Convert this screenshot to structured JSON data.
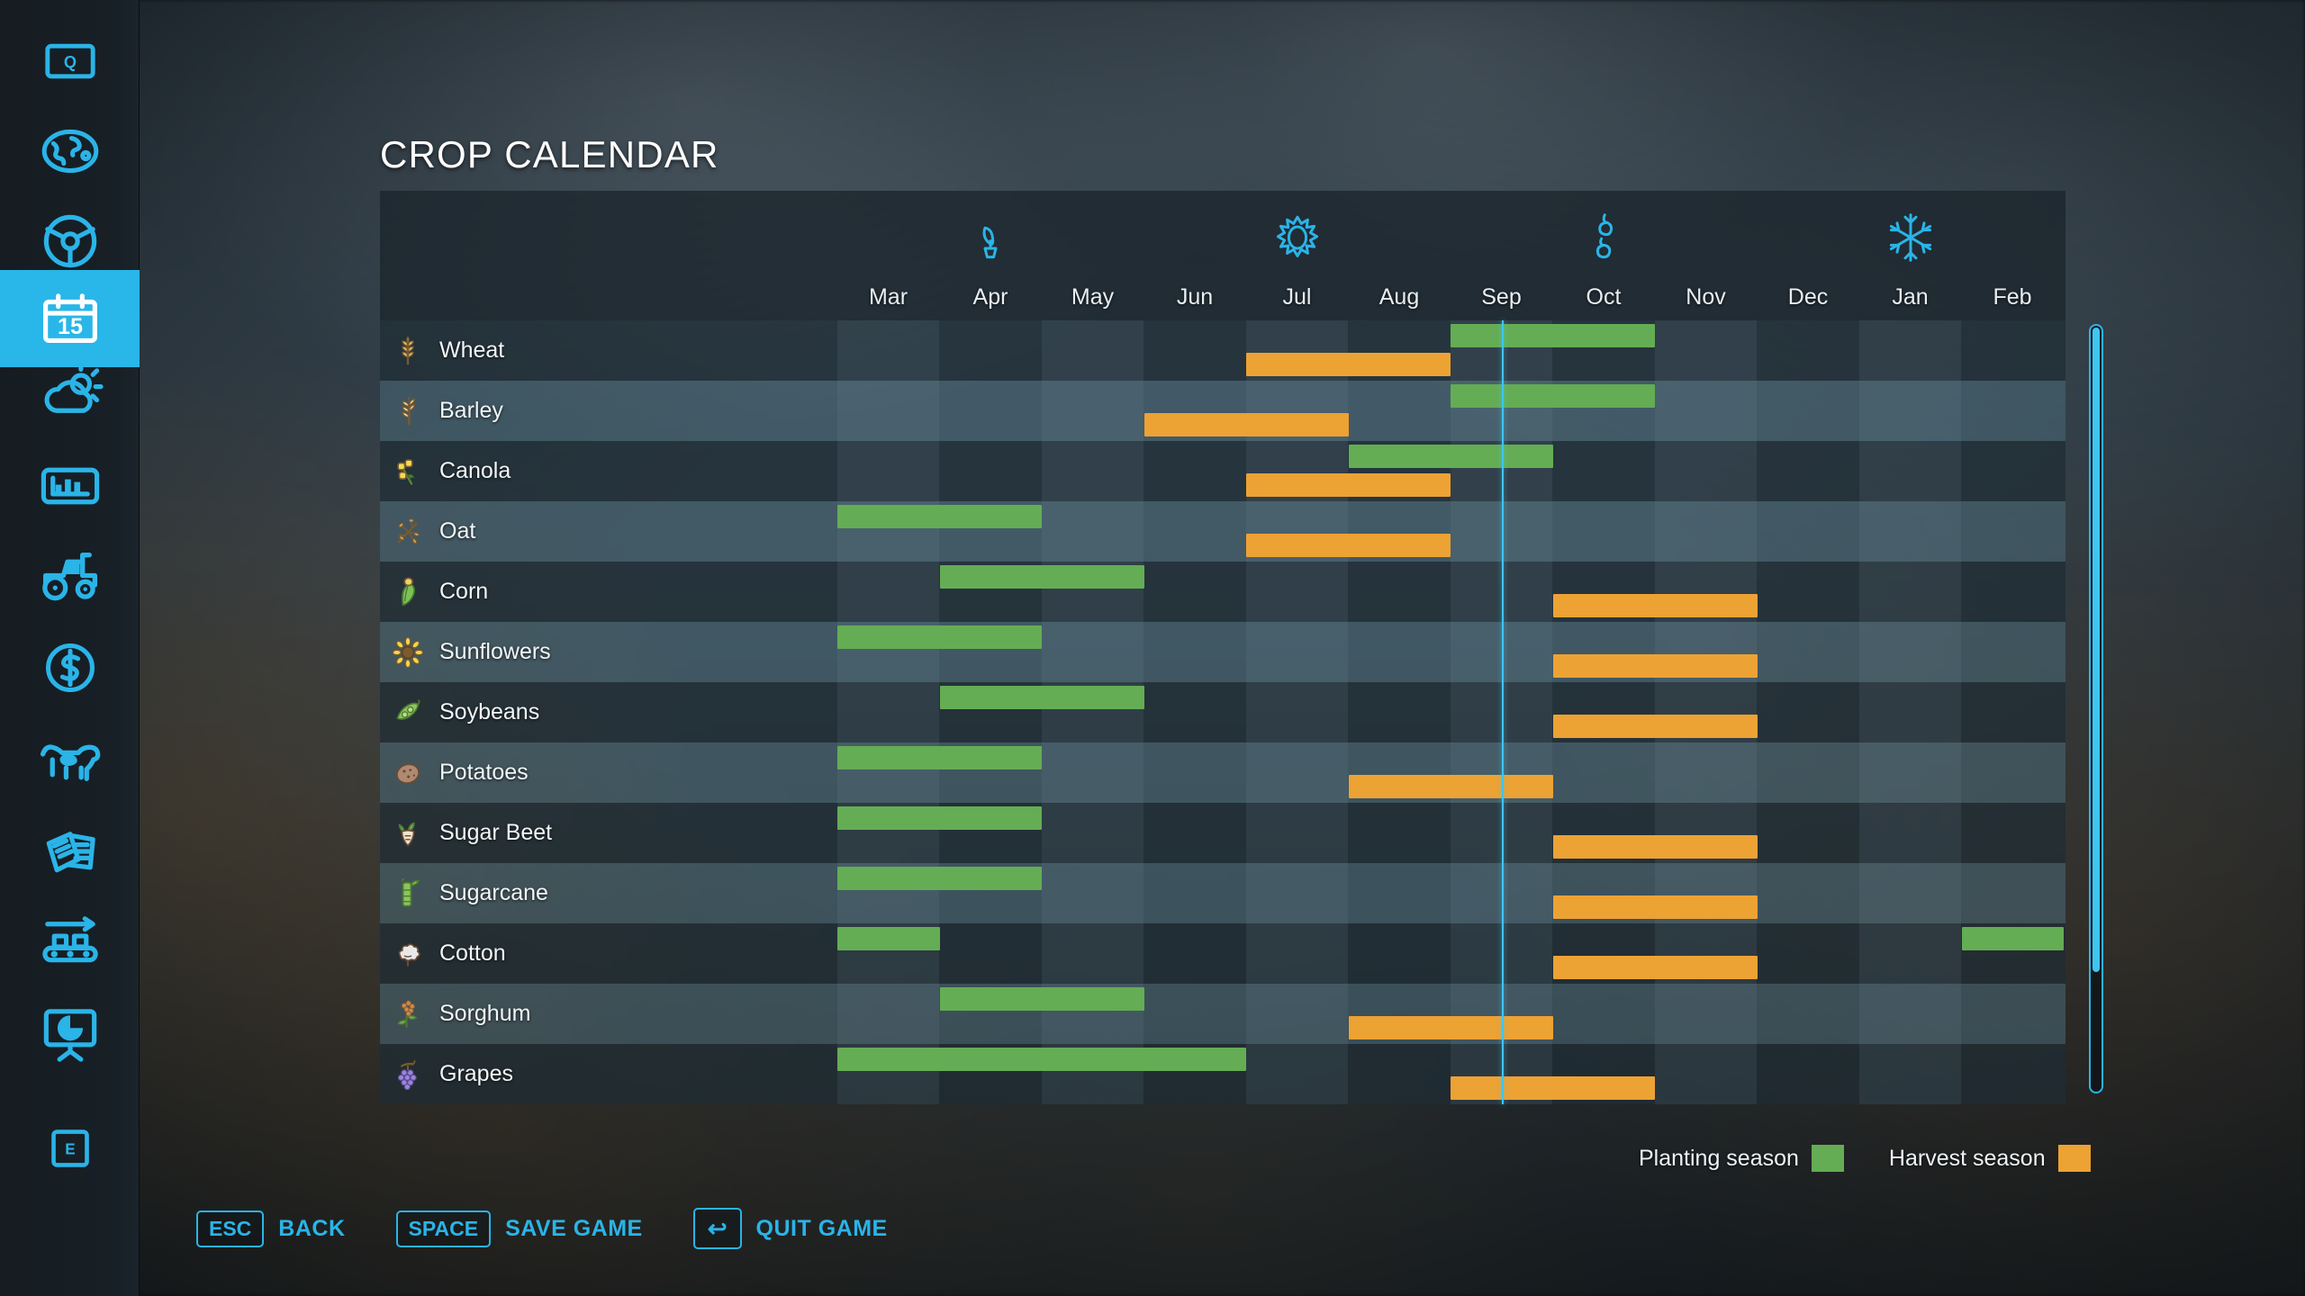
{
  "theme": {
    "accent": "#2ab4e8",
    "plant_color": "#64ad54",
    "harvest_color": "#eda234",
    "panel_bg": "#1b262d"
  },
  "sidebar": {
    "items": [
      {
        "icon": "keycap-q-icon",
        "name": "keycap-q",
        "label": "Q",
        "active": false
      },
      {
        "icon": "globe-icon",
        "name": "map",
        "label": "",
        "active": false
      },
      {
        "icon": "steering-wheel-icon",
        "name": "vehicles",
        "label": "",
        "active": false
      },
      {
        "icon": "calendar-icon",
        "name": "calendar",
        "label": "15",
        "active": true
      },
      {
        "icon": "weather-icon",
        "name": "weather",
        "label": "",
        "active": false
      },
      {
        "icon": "statistics-icon",
        "name": "statistics",
        "label": "",
        "active": false
      },
      {
        "icon": "tractor-icon",
        "name": "machinery",
        "label": "",
        "active": false
      },
      {
        "icon": "dollar-coin-icon",
        "name": "finances",
        "label": "",
        "active": false
      },
      {
        "icon": "cow-icon",
        "name": "animals",
        "label": "",
        "active": false
      },
      {
        "icon": "documents-icon",
        "name": "contracts",
        "label": "",
        "active": false
      },
      {
        "icon": "conveyor-icon",
        "name": "production",
        "label": "",
        "active": false
      },
      {
        "icon": "presentation-icon",
        "name": "construction",
        "label": "",
        "active": false
      },
      {
        "icon": "keycap-e-icon",
        "name": "keycap-e",
        "label": "E",
        "active": false
      }
    ]
  },
  "header": {
    "title": "CROP CALENDAR"
  },
  "chart_data": {
    "type": "table",
    "title": "CROP CALENDAR",
    "months": [
      "Mar",
      "Apr",
      "May",
      "Jun",
      "Jul",
      "Aug",
      "Sep",
      "Oct",
      "Nov",
      "Dec",
      "Jan",
      "Feb"
    ],
    "seasons": [
      {
        "name": "spring",
        "icon": "sprout-icon",
        "month": "Apr"
      },
      {
        "name": "summer",
        "icon": "sun-icon",
        "month": "Jul"
      },
      {
        "name": "autumn",
        "icon": "leaves-icon",
        "month": "Oct"
      },
      {
        "name": "winter",
        "icon": "snowflake-icon",
        "month": "Jan"
      }
    ],
    "current_month_marker": "Sep",
    "legend": [
      {
        "label": "Planting season",
        "color": "#64ad54"
      },
      {
        "label": "Harvest season",
        "color": "#eda234"
      }
    ],
    "crops": [
      {
        "name": "Wheat",
        "icon": "wheat-icon",
        "planting": [
          [
            6,
            8
          ]
        ],
        "harvest": [
          [
            4,
            6
          ]
        ]
      },
      {
        "name": "Barley",
        "icon": "barley-icon",
        "planting": [
          [
            6,
            8
          ]
        ],
        "harvest": [
          [
            3,
            5
          ]
        ]
      },
      {
        "name": "Canola",
        "icon": "canola-icon",
        "planting": [
          [
            5,
            7
          ]
        ],
        "harvest": [
          [
            4,
            6
          ]
        ]
      },
      {
        "name": "Oat",
        "icon": "oat-icon",
        "planting": [
          [
            0,
            2
          ]
        ],
        "harvest": [
          [
            4,
            6
          ]
        ]
      },
      {
        "name": "Corn",
        "icon": "corn-icon",
        "planting": [
          [
            1,
            3
          ]
        ],
        "harvest": [
          [
            7,
            9
          ]
        ]
      },
      {
        "name": "Sunflowers",
        "icon": "sunflower-icon",
        "planting": [
          [
            0,
            2
          ]
        ],
        "harvest": [
          [
            7,
            9
          ]
        ]
      },
      {
        "name": "Soybeans",
        "icon": "soybean-icon",
        "planting": [
          [
            1,
            3
          ]
        ],
        "harvest": [
          [
            7,
            9
          ]
        ]
      },
      {
        "name": "Potatoes",
        "icon": "potato-icon",
        "planting": [
          [
            0,
            2
          ]
        ],
        "harvest": [
          [
            5,
            7
          ]
        ]
      },
      {
        "name": "Sugar Beet",
        "icon": "sugarbeet-icon",
        "planting": [
          [
            0,
            2
          ]
        ],
        "harvest": [
          [
            7,
            9
          ]
        ]
      },
      {
        "name": "Sugarcane",
        "icon": "sugarcane-icon",
        "planting": [
          [
            0,
            2
          ]
        ],
        "harvest": [
          [
            7,
            9
          ]
        ]
      },
      {
        "name": "Cotton",
        "icon": "cotton-icon",
        "planting": [
          [
            0,
            1
          ],
          [
            11,
            12
          ]
        ],
        "harvest": [
          [
            7,
            9
          ]
        ]
      },
      {
        "name": "Sorghum",
        "icon": "sorghum-icon",
        "planting": [
          [
            1,
            3
          ]
        ],
        "harvest": [
          [
            5,
            7
          ]
        ]
      },
      {
        "name": "Grapes",
        "icon": "grapes-icon",
        "planting": [
          [
            0,
            4
          ]
        ],
        "harvest": [
          [
            6,
            8
          ]
        ]
      }
    ]
  },
  "keybar": [
    {
      "cap": "ESC",
      "action": "BACK"
    },
    {
      "cap": "SPACE",
      "action": "SAVE GAME"
    },
    {
      "cap": "↩",
      "action": "QUIT GAME"
    }
  ]
}
